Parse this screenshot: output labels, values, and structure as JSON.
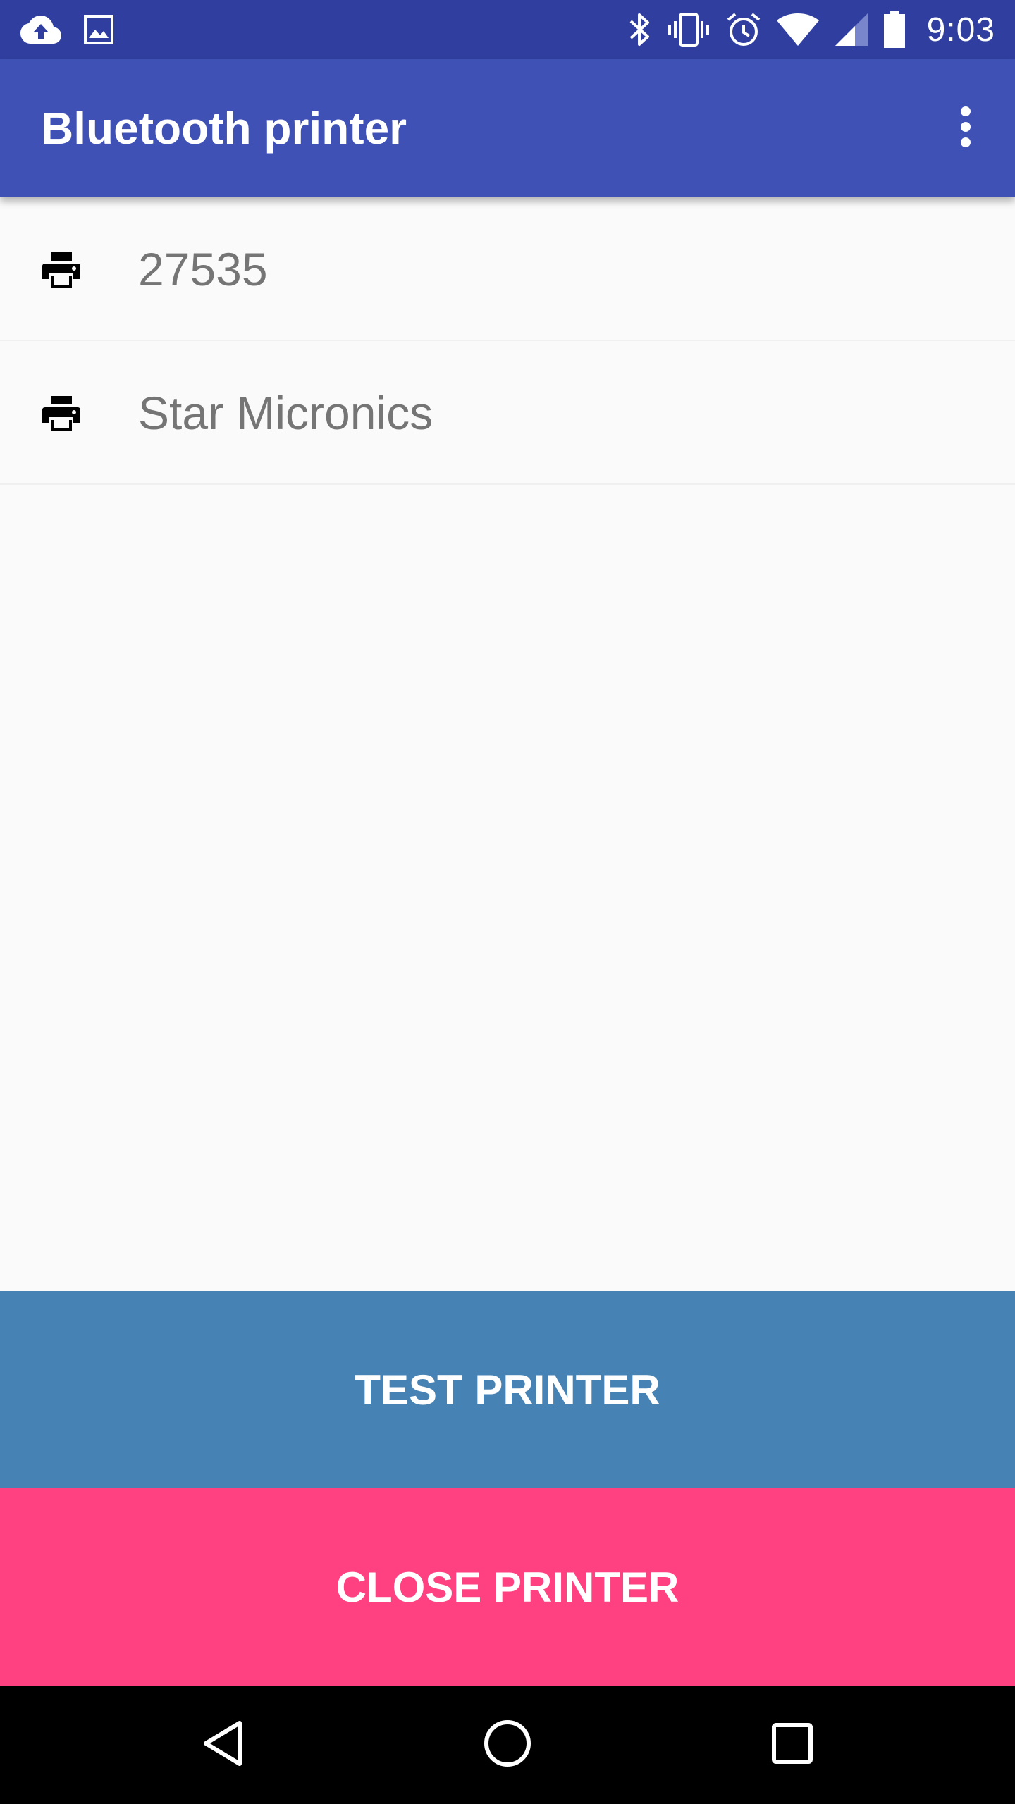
{
  "status_bar": {
    "time": "9:03",
    "left_icons": [
      "cloud-upload-icon",
      "image-icon"
    ],
    "right_icons": [
      "bluetooth-icon",
      "vibrate-icon",
      "alarm-icon",
      "wifi-icon",
      "signal-icon",
      "battery-icon"
    ]
  },
  "app_bar": {
    "title": "Bluetooth printer",
    "menu_icon": "more-vert-icon"
  },
  "printers": [
    {
      "name": "27535",
      "icon": "printer-icon"
    },
    {
      "name": "Star Micronics",
      "icon": "printer-icon"
    }
  ],
  "actions": {
    "test_label": "TEST PRINTER",
    "close_label": "CLOSE PRINTER"
  },
  "nav_bar": {
    "icons": [
      "back-icon",
      "home-icon",
      "recents-icon"
    ]
  },
  "colors": {
    "status_bar": "#303f9f",
    "app_bar": "#3f51b5",
    "test_button": "#4682b4",
    "close_button": "#ff4081",
    "background": "#fafafa",
    "list_text": "#757575"
  }
}
